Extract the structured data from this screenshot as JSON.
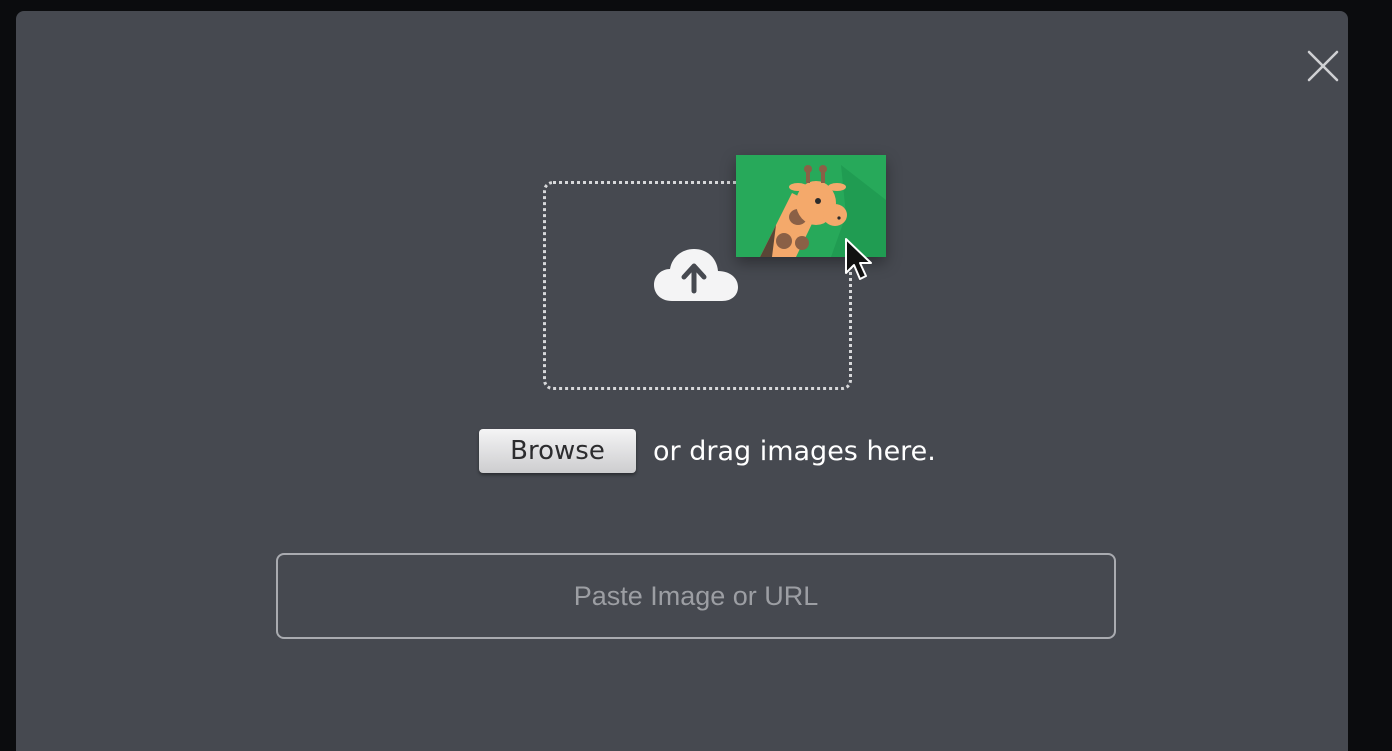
{
  "modal": {
    "close_icon": "close-icon",
    "drop_zone": {
      "upload_icon": "cloud-upload-icon",
      "thumbnail_icon": "giraffe-image-icon",
      "cursor_icon": "mouse-pointer-icon"
    },
    "browse_label": "Browse",
    "drag_text": "or drag images here.",
    "paste_placeholder": "Paste Image or URL"
  },
  "colors": {
    "modal_background": "#464950",
    "page_background": "#0b0c0e",
    "thumbnail_green": "#27a95a",
    "giraffe_orange": "#f4a96b"
  }
}
